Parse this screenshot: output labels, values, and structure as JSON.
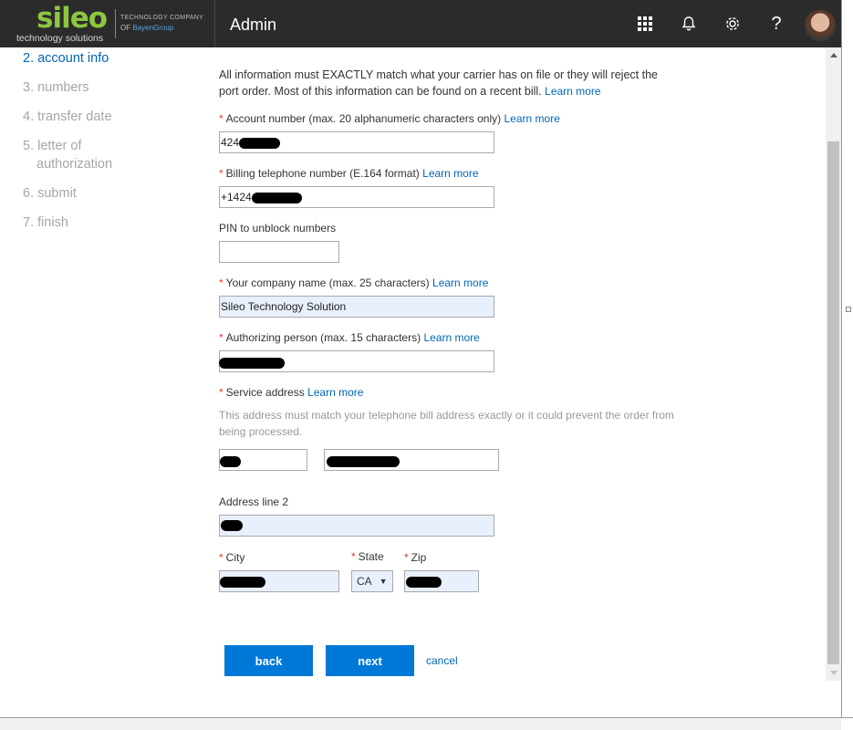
{
  "header": {
    "logo_word": "sileo",
    "logo_sub": "technology solutions",
    "logo_tc1": "TECHNOLOGY COMPANY",
    "logo_tc2_of": "OF",
    "logo_tc2_brand": "BayenGroup",
    "app_title": "Admin",
    "icons": [
      "waffle-icon",
      "bell-icon",
      "gear-icon",
      "help-icon",
      "avatar"
    ],
    "help_glyph": "?"
  },
  "sidebar": {
    "steps": [
      {
        "label": "2. account info",
        "active": true
      },
      {
        "label": "3. numbers"
      },
      {
        "label": "4. transfer date"
      },
      {
        "label": "5. letter of",
        "label2": "authorization"
      },
      {
        "label": "6. submit"
      },
      {
        "label": "7. finish"
      }
    ]
  },
  "form": {
    "intro": "All information must EXACTLY match what your carrier has on file or they will reject the port order. Most of this information can be found on a recent bill.",
    "learn_more": "Learn more",
    "required_mark": "*",
    "account_number": {
      "label": "Account number (max. 20 alphanumeric characters only)",
      "value": "424"
    },
    "billing_phone": {
      "label": "Billing telephone number (E.164 format)",
      "value": "+1424"
    },
    "pin": {
      "label": "PIN to unblock numbers",
      "value": ""
    },
    "company": {
      "label": "Your company name (max. 25 characters)",
      "value": "Sileo Technology Solution"
    },
    "authorizing_person": {
      "label": "Authorizing person (max. 15 characters)",
      "value": ""
    },
    "service_address": {
      "label": "Service address",
      "note": "This address must match your telephone bill address exactly or it could prevent the order from being processed."
    },
    "address_line2": {
      "label": "Address line 2"
    },
    "city": {
      "label": "City"
    },
    "state": {
      "label": "State",
      "value": "CA"
    },
    "zip": {
      "label": "Zip"
    }
  },
  "actions": {
    "back": "back",
    "next": "next",
    "cancel": "cancel"
  },
  "colors": {
    "accent": "#0078d7",
    "brand": "#8dc63f",
    "required": "#e8382c"
  }
}
